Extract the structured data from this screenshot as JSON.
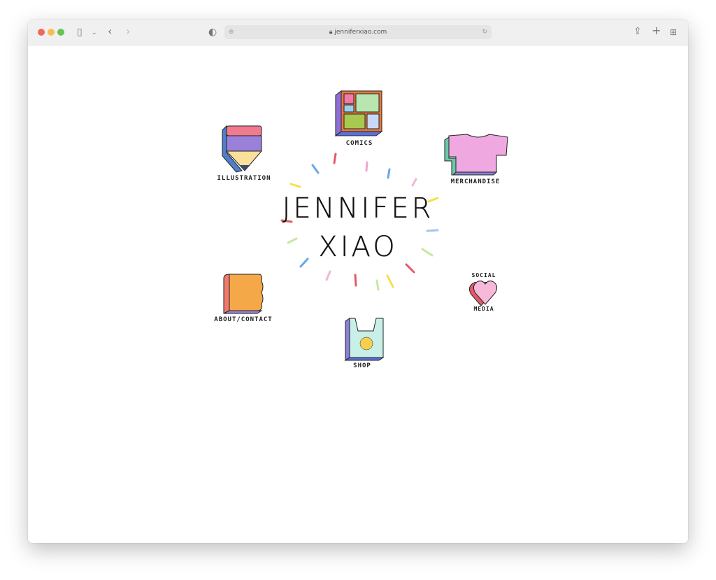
{
  "browser": {
    "url": "jenniferxiao.com"
  },
  "site": {
    "title_line1": "JENNIFER",
    "title_line2": "XIAO",
    "nav": {
      "comics": "COMICS",
      "illustration": "ILLUSTRATION",
      "merchandise": "MERCHANDISE",
      "social_line1": "SOCIAL",
      "social_line2": "MEDIA",
      "about": "ABOUT/CONTACT",
      "shop": "SHOP"
    }
  },
  "colors": {
    "close": "#ed6a5e",
    "minimize": "#f5bf4f",
    "maximize": "#62c554"
  }
}
